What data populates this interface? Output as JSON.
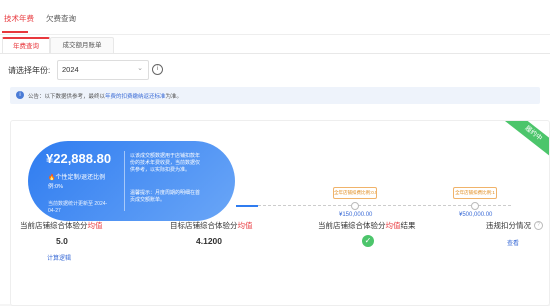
{
  "top_tabs": [
    {
      "label": "技术年费",
      "active": true
    },
    {
      "label": "欠费查询",
      "active": false
    }
  ],
  "sub_tabs": [
    {
      "label": "年费查询",
      "active": true
    },
    {
      "label": "成交额月账单",
      "active": false
    }
  ],
  "year_selector": {
    "label": "请选择年份:",
    "value": "2024"
  },
  "notice": {
    "prefix": "公告：以下数据供参考，最终以",
    "link": "年费的扣费缴纳返还标准",
    "suffix": "为准。"
  },
  "status_ribbon": "履约中",
  "fee_card": {
    "amount": "¥22,888.80",
    "fire_text": "个性定制/退还比例",
    "fire_sub": "例:0%",
    "updated": "当前数据统计更新至 2024-04-27",
    "note": "以该成交额数据用于店铺扣款年份的技术年费收费，当前数据仅供参考，以实际扣费为准。",
    "tip": "温馨提示：月度周期的明细在首页成交额账单。"
  },
  "milestones": [
    {
      "label": "全年店铺扣费比例:0.5",
      "value": "¥150,000.00"
    },
    {
      "label": "全年店铺扣费比例:1",
      "value": "¥500,000.00"
    }
  ],
  "metrics": [
    {
      "label_prefix": "当前店铺综合体验分",
      "label_hl": "均值",
      "label_suffix": "",
      "value": "5.0",
      "link": "计算逻辑"
    },
    {
      "label_prefix": "目标店铺综合体验分",
      "label_hl": "均值",
      "label_suffix": "",
      "value": "4.1200",
      "link": ""
    },
    {
      "label_prefix": "当前店铺综合体验分",
      "label_hl": "均值",
      "label_suffix": "结果",
      "value": "",
      "link": ""
    },
    {
      "label_prefix": "违规扣分情况",
      "label_hl": "",
      "label_suffix": "",
      "value": "",
      "link": "查看"
    }
  ],
  "colors": {
    "accent": "#e8383d",
    "blue": "#2f7cf0",
    "green": "#4cc56b",
    "orange": "#e08a1a"
  }
}
